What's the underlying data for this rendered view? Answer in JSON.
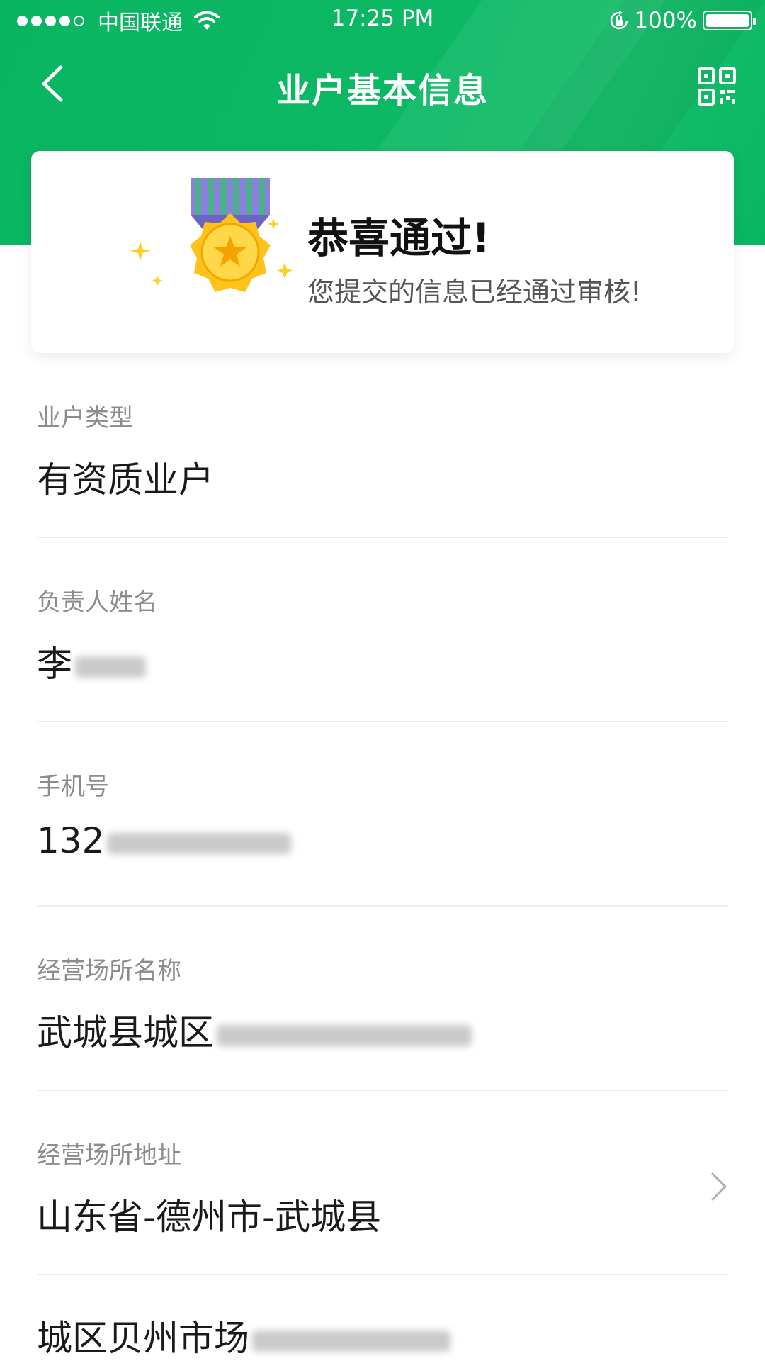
{
  "status_bar": {
    "carrier": "中国联通",
    "time": "17:25 PM",
    "battery": "100%"
  },
  "nav": {
    "title": "业户基本信息",
    "back_icon": "chevron-left-icon",
    "qr_icon": "qr-code-icon"
  },
  "card": {
    "title": "恭喜通过!",
    "subtitle": "您提交的信息已经通过审核!",
    "icon": "medal-icon"
  },
  "fields": [
    {
      "label": "业户类型",
      "value": "有资质业户"
    },
    {
      "label": "负责人姓名",
      "value": "李"
    },
    {
      "label": "手机号",
      "value": "132"
    },
    {
      "label": "经营场所名称",
      "value": "武城县城区"
    },
    {
      "label": "经营场所地址",
      "value": "山东省-德州市-武城县"
    }
  ],
  "address_detail": "城区贝州市场",
  "colors": {
    "header_green": "#0bb562",
    "label_gray": "#8c8c8c",
    "medal_gold": "#f5c000",
    "ribbon_purple": "#8b7fe0"
  }
}
